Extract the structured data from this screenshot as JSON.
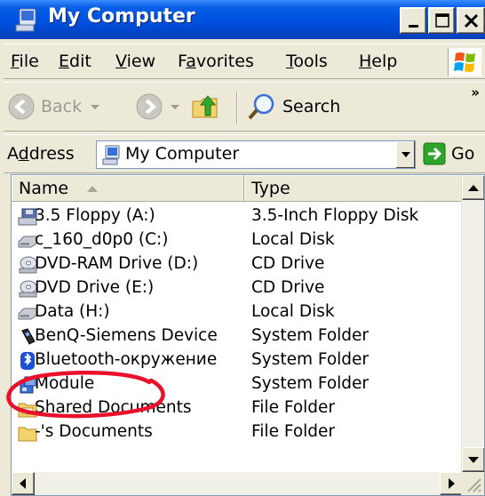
{
  "window": {
    "title": "My Computer",
    "icon": "my-computer-icon",
    "controls": [
      "minimize-icon",
      "maximize-icon",
      "close-icon"
    ]
  },
  "menu": {
    "items": [
      {
        "label": "File",
        "u": "F",
        "rest": "ile"
      },
      {
        "label": "Edit",
        "u": "E",
        "rest": "dit"
      },
      {
        "label": "View",
        "u": "V",
        "rest": "iew"
      },
      {
        "label": "Favorites",
        "pre": "F",
        "u": "a",
        "rest": "vorites"
      },
      {
        "label": "Tools",
        "u": "T",
        "rest": "ools"
      },
      {
        "label": "Help",
        "u": "H",
        "rest": "elp"
      }
    ]
  },
  "toolbar": {
    "back_label": "Back",
    "search_label": "Search",
    "more": "»"
  },
  "address": {
    "label_pre": "A",
    "label_u": "d",
    "label_rest": "dress",
    "value": "My Computer",
    "go_label": "Go"
  },
  "list": {
    "columns": {
      "name": "Name",
      "type": "Type"
    },
    "rows": [
      {
        "name": "3.5 Floppy (A:)",
        "type": "3.5-Inch Floppy Disk",
        "icon": "floppy-icon"
      },
      {
        "name": "c_160_d0p0 (C:)",
        "type": "Local Disk",
        "icon": "hard-disk-icon"
      },
      {
        "name": "DVD-RAM Drive (D:)",
        "type": "CD Drive",
        "icon": "dvd-drive-icon"
      },
      {
        "name": "DVD Drive (E:)",
        "type": "CD Drive",
        "icon": "dvd-drive-icon"
      },
      {
        "name": "Data (H:)",
        "type": "Local Disk",
        "icon": "hard-disk-icon"
      },
      {
        "name": "BenQ-Siemens Device",
        "type": "System Folder",
        "icon": "phone-device-icon"
      },
      {
        "name": "Bluetooth-окружение",
        "type": "System Folder",
        "icon": "bluetooth-icon"
      },
      {
        "name": "Module",
        "type": "System Folder",
        "icon": "module-icon"
      },
      {
        "name": "Shared Documents",
        "type": "File Folder",
        "icon": "folder-icon"
      },
      {
        "name": "-'s Documents",
        "type": "File Folder",
        "icon": "folder-icon"
      }
    ]
  },
  "colors": {
    "titlebar": "#0054e3",
    "annotation": "#e8102a",
    "face": "#ece9d8"
  }
}
